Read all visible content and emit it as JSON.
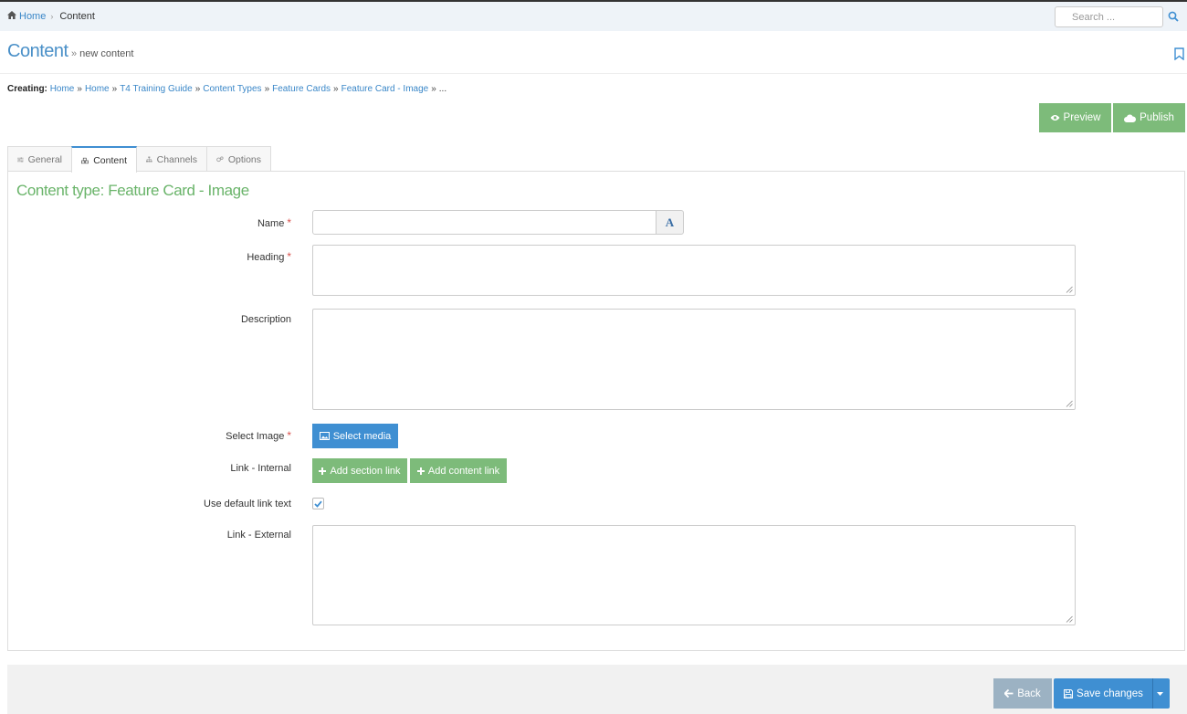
{
  "topbar": {
    "breadcrumb": [
      "Home",
      "Content"
    ],
    "search_placeholder": "Search ..."
  },
  "header": {
    "title": "Content",
    "subtitle": "new content"
  },
  "creating": {
    "label": "Creating:",
    "path": [
      "Home",
      "Home",
      "T4 Training Guide",
      "Content Types",
      "Feature Cards",
      "Feature Card - Image"
    ],
    "trail": "..."
  },
  "actions": {
    "preview": "Preview",
    "publish": "Publish"
  },
  "tabs": [
    {
      "label": "General",
      "active": false
    },
    {
      "label": "Content",
      "active": true
    },
    {
      "label": "Channels",
      "active": false
    },
    {
      "label": "Options",
      "active": false
    }
  ],
  "form": {
    "content_type_title": "Content type: Feature Card - Image",
    "name_label": "Name",
    "name_value": "",
    "heading_label": "Heading",
    "description_label": "Description",
    "select_image_label": "Select Image",
    "select_media_button": "Select media",
    "link_internal_label": "Link - Internal",
    "add_section_link_button": "Add section link",
    "add_content_link_button": "Add content link",
    "default_link_label": "Use default link text",
    "default_link_checked": true,
    "link_external_label": "Link - External"
  },
  "footer": {
    "back": "Back",
    "save": "Save changes"
  },
  "colors": {
    "accent_blue": "#3f8fd2",
    "accent_green": "#7dbb7a",
    "link": "#3a87c8",
    "required": "#d9534f"
  }
}
